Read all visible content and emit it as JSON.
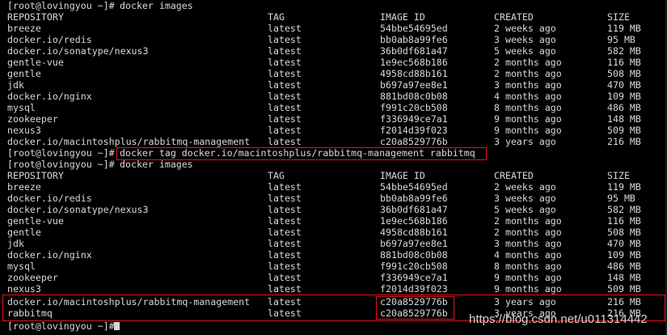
{
  "terminal": {
    "prompt": "[root@lovingyou ~]#",
    "commands": {
      "list_images": "docker images",
      "tag": "docker tag docker.io/macintoshplus/rabbitmq-management rabbitmq"
    },
    "headers": {
      "repository": "REPOSITORY",
      "tag": "TAG",
      "image_id": "IMAGE ID",
      "created": "CREATED",
      "size": "SIZE"
    },
    "listing1": [
      {
        "repo": "breeze",
        "tag": "latest",
        "id": "54bbe54695ed",
        "created": "2 weeks ago",
        "size": "119 MB"
      },
      {
        "repo": "docker.io/redis",
        "tag": "latest",
        "id": "bb0ab8a99fe6",
        "created": "3 weeks ago",
        "size": "95 MB"
      },
      {
        "repo": "docker.io/sonatype/nexus3",
        "tag": "latest",
        "id": "36b0df681a47",
        "created": "5 weeks ago",
        "size": "582 MB"
      },
      {
        "repo": "gentle-vue",
        "tag": "latest",
        "id": "1e9ec568b186",
        "created": "2 months ago",
        "size": "116 MB"
      },
      {
        "repo": "gentle",
        "tag": "latest",
        "id": "4958cd88b161",
        "created": "2 months ago",
        "size": "508 MB"
      },
      {
        "repo": "jdk",
        "tag": "latest",
        "id": "b697a97ee8e1",
        "created": "3 months ago",
        "size": "470 MB"
      },
      {
        "repo": "docker.io/nginx",
        "tag": "latest",
        "id": "881bd08c0b08",
        "created": "4 months ago",
        "size": "109 MB"
      },
      {
        "repo": "mysql",
        "tag": "latest",
        "id": "f991c20cb508",
        "created": "8 months ago",
        "size": "486 MB"
      },
      {
        "repo": "zookeeper",
        "tag": "latest",
        "id": "f336949ce7a1",
        "created": "9 months ago",
        "size": "148 MB"
      },
      {
        "repo": "nexus3",
        "tag": "latest",
        "id": "f2014d39f023",
        "created": "9 months ago",
        "size": "509 MB"
      },
      {
        "repo": "docker.io/macintoshplus/rabbitmq-management",
        "tag": "latest",
        "id": "c20a8529776b",
        "created": "3 years ago",
        "size": "216 MB"
      }
    ],
    "listing2": [
      {
        "repo": "breeze",
        "tag": "latest",
        "id": "54bbe54695ed",
        "created": "2 weeks ago",
        "size": "119 MB"
      },
      {
        "repo": "docker.io/redis",
        "tag": "latest",
        "id": "bb0ab8a99fe6",
        "created": "3 weeks ago",
        "size": "95 MB"
      },
      {
        "repo": "docker.io/sonatype/nexus3",
        "tag": "latest",
        "id": "36b0df681a47",
        "created": "5 weeks ago",
        "size": "582 MB"
      },
      {
        "repo": "gentle-vue",
        "tag": "latest",
        "id": "1e9ec568b186",
        "created": "2 months ago",
        "size": "116 MB"
      },
      {
        "repo": "gentle",
        "tag": "latest",
        "id": "4958cd88b161",
        "created": "2 months ago",
        "size": "508 MB"
      },
      {
        "repo": "jdk",
        "tag": "latest",
        "id": "b697a97ee8e1",
        "created": "3 months ago",
        "size": "470 MB"
      },
      {
        "repo": "docker.io/nginx",
        "tag": "latest",
        "id": "881bd08c0b08",
        "created": "4 months ago",
        "size": "109 MB"
      },
      {
        "repo": "mysql",
        "tag": "latest",
        "id": "f991c20cb508",
        "created": "8 months ago",
        "size": "486 MB"
      },
      {
        "repo": "zookeeper",
        "tag": "latest",
        "id": "f336949ce7a1",
        "created": "9 months ago",
        "size": "148 MB"
      },
      {
        "repo": "nexus3",
        "tag": "latest",
        "id": "f2014d39f023",
        "created": "9 months ago",
        "size": "509 MB"
      },
      {
        "repo": "docker.io/macintoshplus/rabbitmq-management",
        "tag": "latest",
        "id": "c20a8529776b",
        "created": "3 years ago",
        "size": "216 MB"
      },
      {
        "repo": "rabbitmq",
        "tag": "latest",
        "id": "c20a8529776b",
        "created": "3 years ago",
        "size": "216 MB"
      }
    ]
  },
  "watermark": "https://blog.csdn.net/u011314442",
  "colors": {
    "background": "#000000",
    "text": "#d8d8d8",
    "highlight": "#e0141b"
  }
}
